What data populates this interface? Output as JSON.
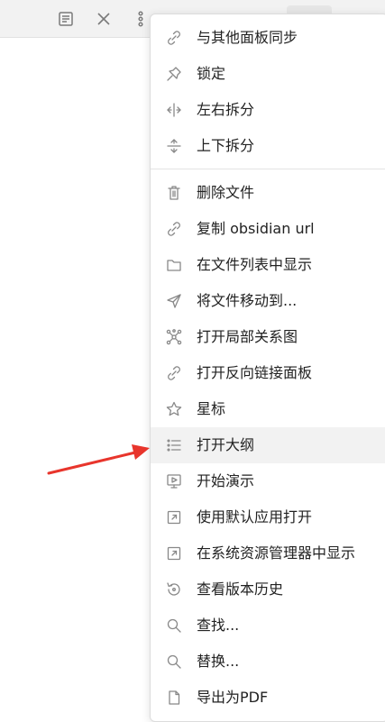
{
  "colors": {
    "accent_arrow": "#e8352c",
    "icon": "#888888",
    "text": "#222222",
    "highlight": "#f2f2f2"
  },
  "toolbar": {
    "icons": [
      "reading-view-icon",
      "close-icon",
      "more-options-icon"
    ]
  },
  "menu": {
    "groups": [
      [
        {
          "label": "与其他面板同步",
          "icon": "link-icon"
        },
        {
          "label": "锁定",
          "icon": "pin-icon"
        },
        {
          "label": "左右拆分",
          "icon": "split-vertical-icon"
        },
        {
          "label": "上下拆分",
          "icon": "split-horizontal-icon"
        }
      ],
      [
        {
          "label": "删除文件",
          "icon": "trash-icon"
        },
        {
          "label": "复制 obsidian url",
          "icon": "link-icon"
        },
        {
          "label": "在文件列表中显示",
          "icon": "folder-icon"
        },
        {
          "label": "将文件移动到...",
          "icon": "send-icon"
        },
        {
          "label": "打开局部关系图",
          "icon": "graph-icon"
        },
        {
          "label": "打开反向链接面板",
          "icon": "link-icon"
        },
        {
          "label": "星标",
          "icon": "star-icon"
        },
        {
          "label": "打开大纲",
          "icon": "list-icon",
          "highlighted": true
        },
        {
          "label": "开始演示",
          "icon": "presentation-icon"
        },
        {
          "label": "使用默认应用打开",
          "icon": "external-open-icon"
        },
        {
          "label": "在系统资源管理器中显示",
          "icon": "external-open-icon"
        },
        {
          "label": "查看版本历史",
          "icon": "history-icon"
        },
        {
          "label": "查找...",
          "icon": "search-icon"
        },
        {
          "label": "替换...",
          "icon": "search-icon"
        },
        {
          "label": "导出为PDF",
          "icon": "file-icon"
        }
      ]
    ]
  }
}
